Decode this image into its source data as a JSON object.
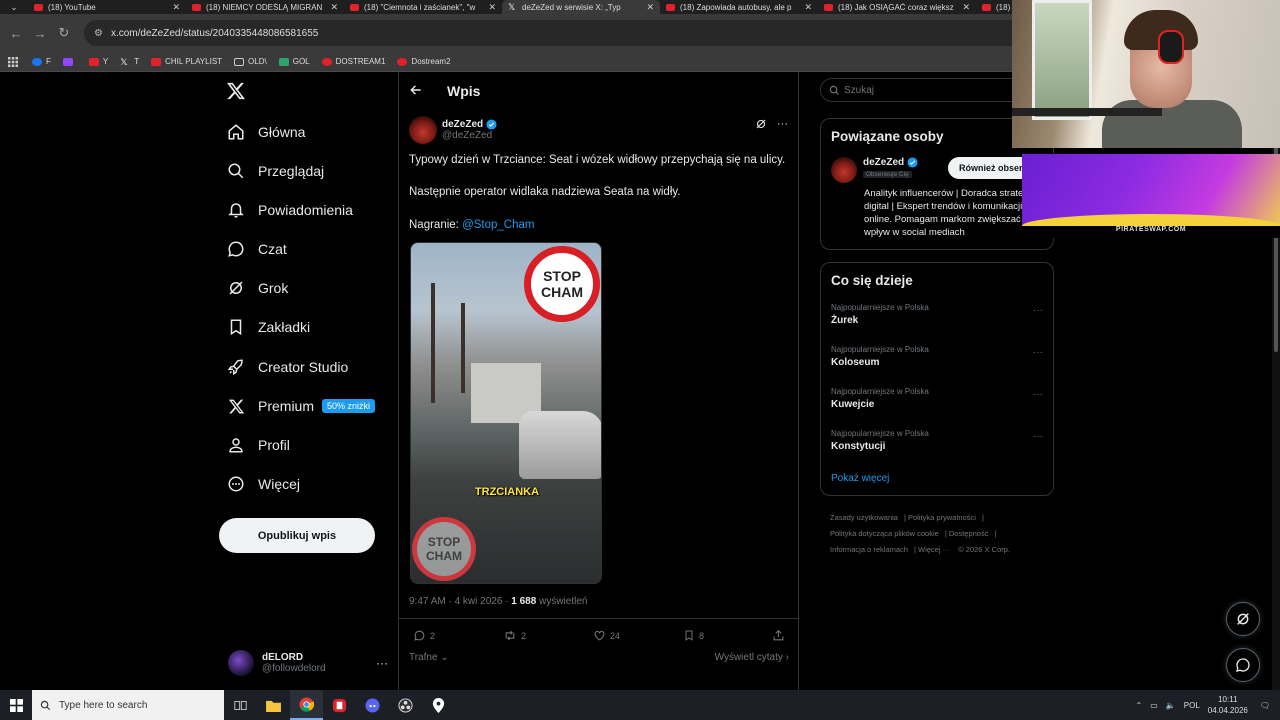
{
  "browser": {
    "tabs": [
      {
        "title": "(18) YouTube",
        "icon": "youtube-icon"
      },
      {
        "title": "(18) NIEMCY ODEŚLĄ MIGRAN",
        "icon": "youtube-icon"
      },
      {
        "title": "(18) \"Ciemnota i zaścianek\", \"w",
        "icon": "youtube-icon"
      },
      {
        "title": "deZeZed w serwisie X: „Typ",
        "icon": "x-icon",
        "active": true
      },
      {
        "title": "(18) Zapowiada autobusy, ale p",
        "icon": "youtube-icon"
      },
      {
        "title": "(18) Jak OSIĄGAĆ coraz większ",
        "icon": "youtube-icon"
      },
      {
        "title": "(18)",
        "icon": "youtube-icon"
      }
    ],
    "url": "x.com/deZeZed/status/2040335448086581655",
    "bookmarks": [
      {
        "label": "F",
        "color": "#1877f2"
      },
      {
        "label": "",
        "color": "#9146ff"
      },
      {
        "label": "Y",
        "color": "#e1222a"
      },
      {
        "label": "T",
        "color": "#ffffff"
      },
      {
        "label": "CHIL PLAYLIST",
        "color": "#e1222a"
      },
      {
        "label": "OLD\\",
        "color": "#888888"
      },
      {
        "label": "GOL",
        "color": "#2fa36b"
      },
      {
        "label": "DOSTREAM1",
        "color": "#e1222a"
      },
      {
        "label": "Dostream2",
        "color": "#e1222a"
      }
    ]
  },
  "nav": {
    "items": [
      {
        "label": "Główna",
        "icon": "home-icon"
      },
      {
        "label": "Przeglądaj",
        "icon": "search-icon"
      },
      {
        "label": "Powiadomienia",
        "icon": "bell-icon"
      },
      {
        "label": "Czat",
        "icon": "chat-icon"
      },
      {
        "label": "Grok",
        "icon": "grok-icon"
      },
      {
        "label": "Zakładki",
        "icon": "bookmark-icon"
      },
      {
        "label": "Creator Studio",
        "icon": "rocket-icon"
      },
      {
        "label": "Premium",
        "icon": "x-premium-icon"
      },
      {
        "label": "Profil",
        "icon": "profile-icon"
      },
      {
        "label": "Więcej",
        "icon": "more-circle-icon"
      }
    ],
    "premium_badge": "50% zniżki",
    "post_button": "Opublikuj wpis",
    "account": {
      "name": "dELORD",
      "handle": "@followdelord"
    }
  },
  "main": {
    "header_title": "Wpis",
    "tweet": {
      "author_name": "deZeZed",
      "author_handle": "@deZeZed",
      "text1": "Typowy dzień w Trzciance: Seat i wózek widłowy przepychają się na ulicy.",
      "text2": "Następnie operator widlaka nadziewa Seata na widły.",
      "text3_prefix": "Nagranie: ",
      "text3_link": "@Stop_Cham",
      "video": {
        "sign_line1": "STOP",
        "sign_line2": "CHAM",
        "caption": "TRZCIANKA"
      },
      "time": "9:47 AM · 4 kwi 2026 · ",
      "views": "1 688",
      "views_label": " wyświetleń",
      "replies": "2",
      "reposts": "2",
      "likes": "24",
      "bookmarks": "8",
      "sort_label": "Trafne",
      "quotes_link": "Wyświetl cytaty"
    }
  },
  "sidebar": {
    "search_placeholder": "Szukaj",
    "related": {
      "title": "Powiązane osoby",
      "name": "deZeZed",
      "follows_you": "Obserwuje Cię",
      "follow_button": "Również obserwuj",
      "bio": "Analityk influencerów | Doradca strategii digital | Ekspert trendów i komunikacji online. Pomagam markom zwiększać wpływ w social mediach"
    },
    "trends": {
      "title": "Co się dzieje",
      "items": [
        {
          "category": "Najpopularniejsze w Polska",
          "name": "Żurek"
        },
        {
          "category": "Najpopularniejsze w Polska",
          "name": "Koloseum"
        },
        {
          "category": "Najpopularniejsze w Polska",
          "name": "Kuwejcie"
        },
        {
          "category": "Najpopularniejsze w Polska",
          "name": "Konstytucji"
        }
      ],
      "show_more": "Pokaż więcej"
    },
    "footer": {
      "l1": "Zasady użytkowania",
      "l2": "Polityka prywatności",
      "l3": "Polityka dotycząca plików cookie",
      "l4": "Dostępność",
      "l5": "Informacja o reklamach",
      "l6": "Więcej ···",
      "l7": "© 2026 X Corp."
    }
  },
  "overlay": {
    "ad_label": "PIRATESWAP.COM"
  },
  "taskbar": {
    "search_placeholder": "Type here to search",
    "lang": "POL",
    "time": "10:11",
    "date": "04.04.2026"
  }
}
